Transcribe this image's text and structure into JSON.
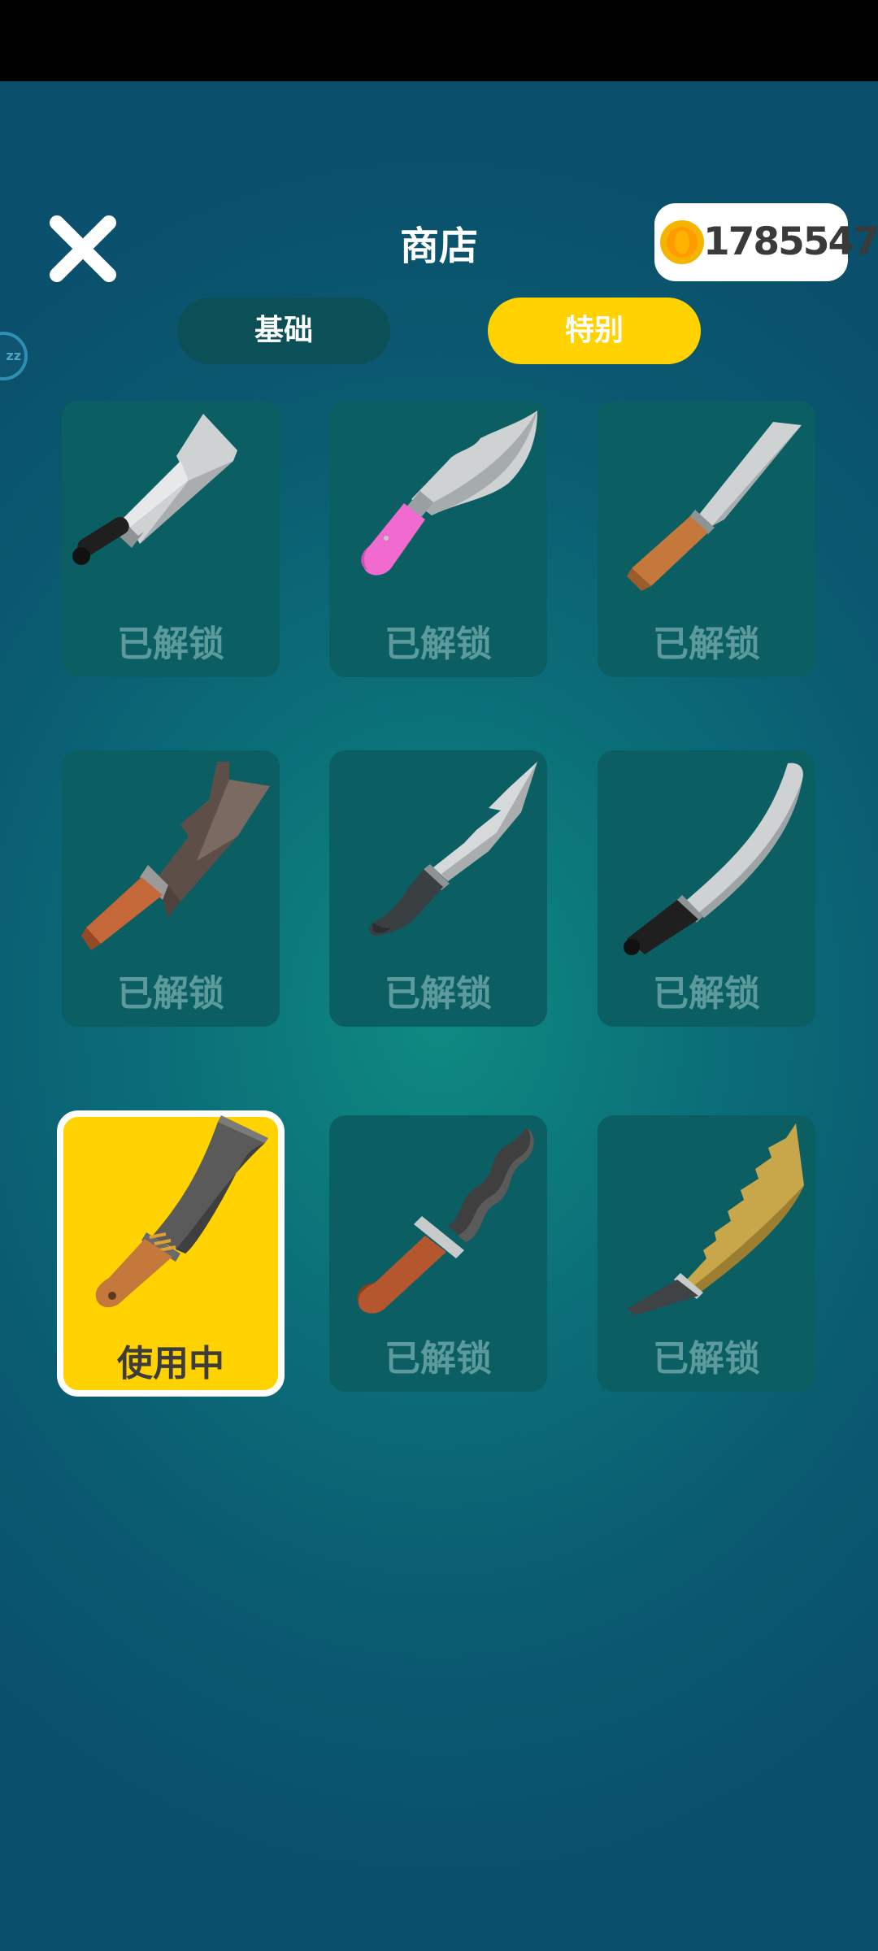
{
  "header": {
    "title": "商店",
    "coins": "1785547",
    "side_badge": "zz"
  },
  "tabs": [
    {
      "label": "基础",
      "active": false
    },
    {
      "label": "特别",
      "active": true
    }
  ],
  "colors": {
    "accent": "#ffd200",
    "card": "#0b5e62",
    "tab_inactive": "#0b4f57",
    "locked_text": "#5c9a9c"
  },
  "items": [
    {
      "name": "black-handle-cleaver",
      "status": "已解锁",
      "selected": false
    },
    {
      "name": "pink-handle-hook-knife",
      "status": "已解锁",
      "selected": false
    },
    {
      "name": "wood-handle-chef-knife",
      "status": "已解锁",
      "selected": false
    },
    {
      "name": "rusty-notched-cleaver",
      "status": "已解锁",
      "selected": false
    },
    {
      "name": "serrated-hunting-knife",
      "status": "已解锁",
      "selected": false
    },
    {
      "name": "curved-scimitar-knife",
      "status": "已解锁",
      "selected": false
    },
    {
      "name": "machete-blade",
      "status": "使用中",
      "selected": true
    },
    {
      "name": "wavy-kris-dagger",
      "status": "已解锁",
      "selected": false
    },
    {
      "name": "golden-serrated-sword",
      "status": "已解锁",
      "selected": false
    }
  ]
}
